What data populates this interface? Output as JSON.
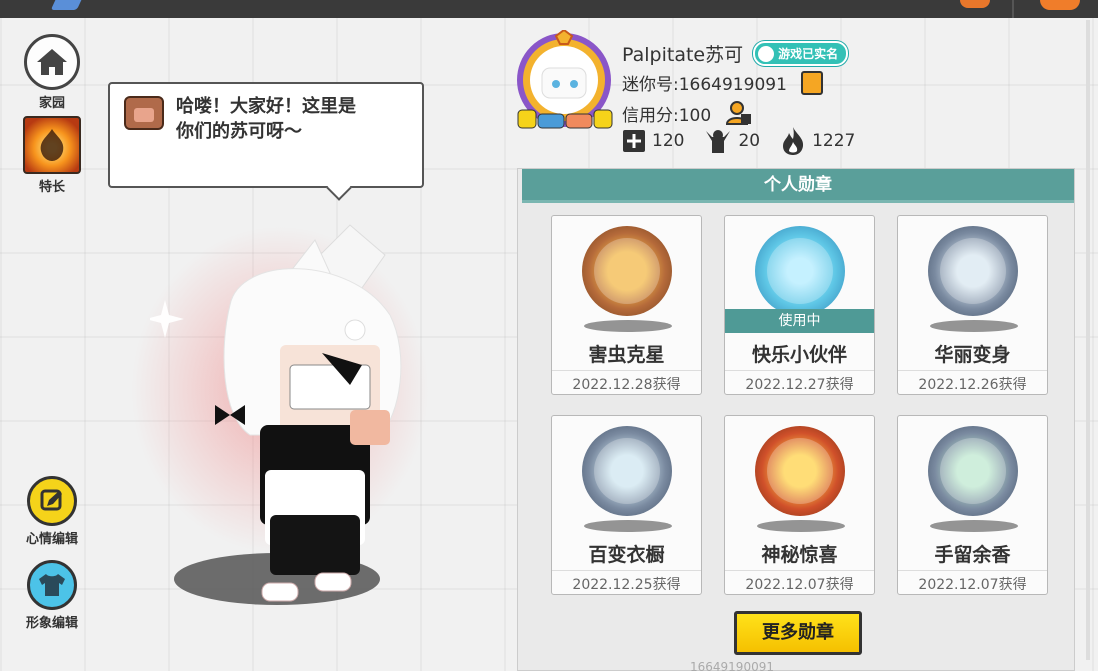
{
  "left_menu": {
    "home_label": "家园",
    "talent_label": "特长",
    "mood_label": "心情编辑",
    "appearance_label": "形象编辑"
  },
  "speech_bubble": {
    "text": "哈喽！大家好！这里是\n你们的苏可呀～"
  },
  "profile": {
    "name": "Palpitate苏可",
    "verified_badge": "游戏已实名",
    "mini_id": "迷你号:1664919091",
    "credit": "信用分:100",
    "stats": {
      "friends": "120",
      "fans": "20",
      "heat": "1227"
    }
  },
  "medals": {
    "header": "个人勋章",
    "in_use_label": "使用中",
    "items": [
      {
        "name": "害虫克星",
        "date": "2022.12.28获得",
        "color": "#b56a3a"
      },
      {
        "name": "快乐小伙伴",
        "date": "2022.12.27获得",
        "color": "#5fc7e6"
      },
      {
        "name": "华丽变身",
        "date": "2022.12.26获得",
        "color": "#7a8aa0"
      },
      {
        "name": "百变衣橱",
        "date": "2022.12.25获得",
        "color": "#7a8aa0"
      },
      {
        "name": "神秘惊喜",
        "date": "2022.12.07获得",
        "color": "#b56a3a"
      },
      {
        "name": "手留余香",
        "date": "2022.12.07获得",
        "color": "#7a8aa0"
      }
    ],
    "more_button": "更多勋章"
  },
  "footer_faint": "16649190091"
}
